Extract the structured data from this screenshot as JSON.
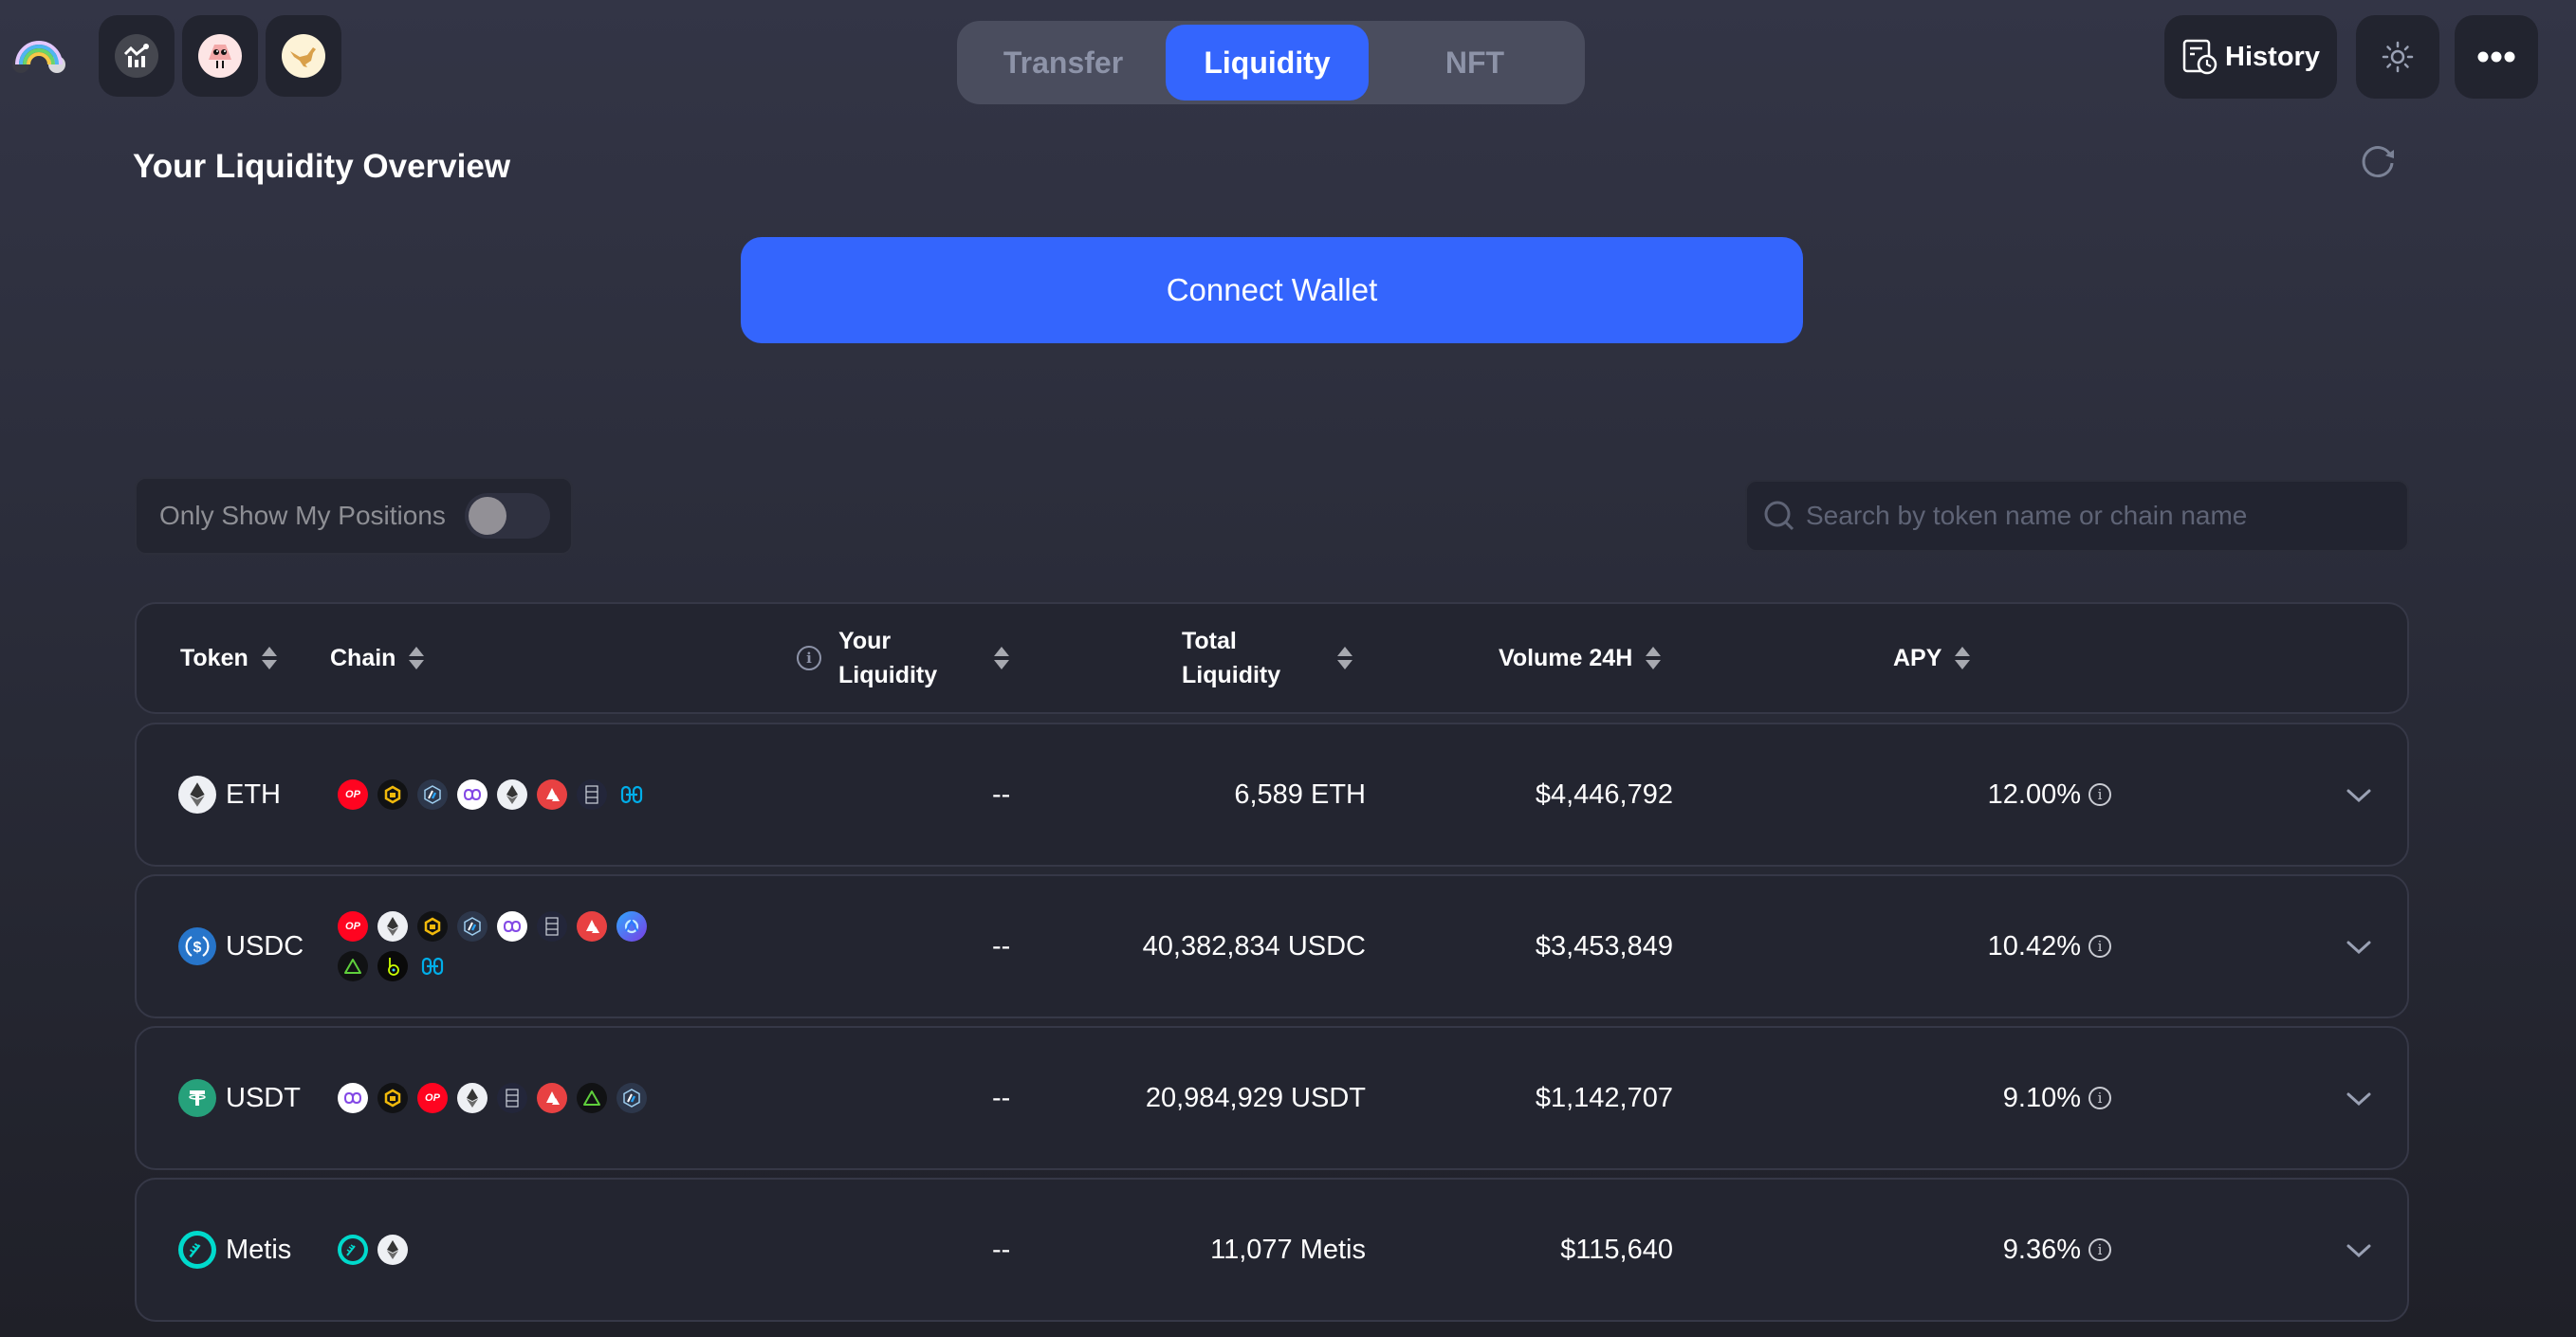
{
  "header": {
    "apps": [
      {
        "name": "analytics-app",
        "icon": "chart-icon"
      },
      {
        "name": "ghost-app",
        "icon": "ghost-icon"
      },
      {
        "name": "kangaroo-app",
        "icon": "kangaroo-icon"
      }
    ],
    "tabs": [
      {
        "label": "Transfer",
        "active": false
      },
      {
        "label": "Liquidity",
        "active": true
      },
      {
        "label": "NFT",
        "active": false
      }
    ],
    "history_label": "History"
  },
  "overview": {
    "title": "Your Liquidity Overview",
    "connect_wallet_label": "Connect Wallet"
  },
  "filters": {
    "toggle_label": "Only Show My Positions",
    "toggle_on": false,
    "search_placeholder": "Search by token name or chain name",
    "search_value": ""
  },
  "table": {
    "columns": [
      "Token",
      "Chain",
      "Your Liquidity",
      "Total Liquidity",
      "Volume 24H",
      "APY"
    ],
    "rows": [
      {
        "token": "ETH",
        "token_icon": "eth-icon",
        "chains": [
          "optimism",
          "bnb",
          "arbitrum",
          "polygon",
          "ethereum",
          "avalanche",
          "fantom",
          "harmony"
        ],
        "your_liquidity": "--",
        "total_liquidity": "6,589 ETH",
        "volume_24h": "$4,446,792",
        "apy": "12.00%"
      },
      {
        "token": "USDC",
        "token_icon": "usdc-icon",
        "chains": [
          "optimism",
          "ethereum",
          "bnb",
          "arbitrum",
          "polygon",
          "fantom",
          "avalanche",
          "moonriver",
          "nova",
          "boba",
          "harmony"
        ],
        "your_liquidity": "--",
        "total_liquidity": "40,382,834 USDC",
        "volume_24h": "$3,453,849",
        "apy": "10.42%"
      },
      {
        "token": "USDT",
        "token_icon": "usdt-icon",
        "chains": [
          "polygon",
          "bnb",
          "optimism",
          "ethereum",
          "fantom",
          "avalanche",
          "nova",
          "arbitrum"
        ],
        "your_liquidity": "--",
        "total_liquidity": "20,984,929 USDT",
        "volume_24h": "$1,142,707",
        "apy": "9.10%"
      },
      {
        "token": "Metis",
        "token_icon": "metis-icon",
        "chains": [
          "metis",
          "ethereum"
        ],
        "your_liquidity": "--",
        "total_liquidity": "11,077 Metis",
        "volume_24h": "$115,640",
        "apy": "9.36%"
      }
    ]
  },
  "colors": {
    "accent": "#3465fd",
    "background": "#2a2c39",
    "card": "#232530"
  }
}
